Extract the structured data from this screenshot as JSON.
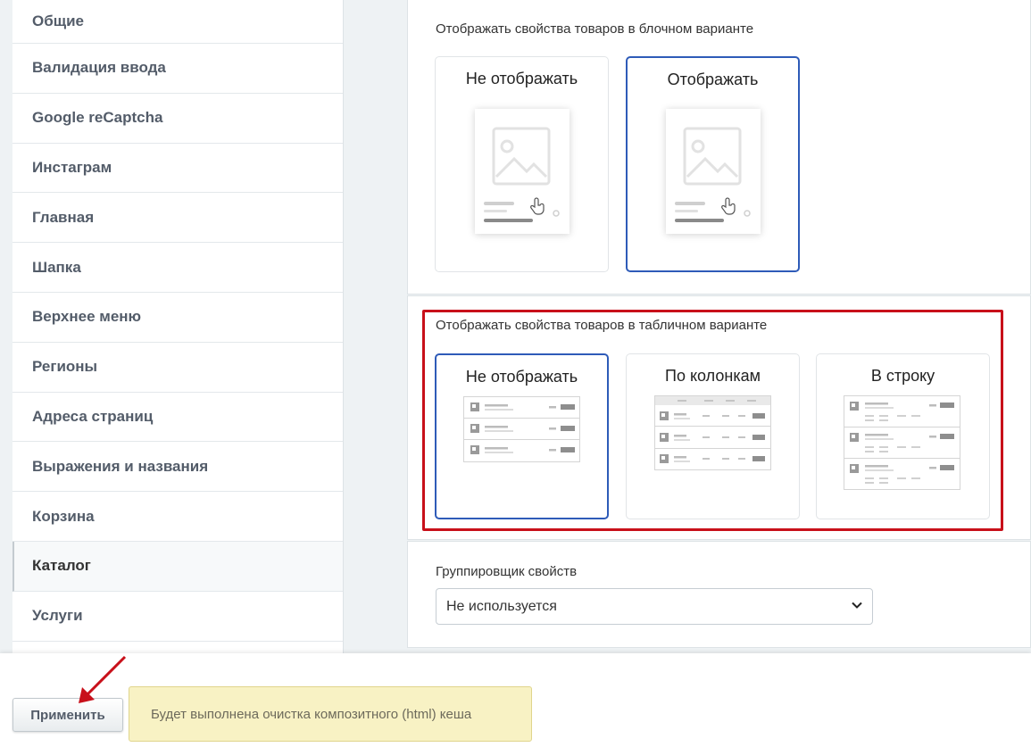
{
  "sidebar": {
    "items": [
      {
        "label": "Общие"
      },
      {
        "label": "Валидация ввода"
      },
      {
        "label": "Google reCaptcha"
      },
      {
        "label": "Инстаграм"
      },
      {
        "label": "Главная"
      },
      {
        "label": "Шапка"
      },
      {
        "label": "Верхнее меню"
      },
      {
        "label": "Регионы"
      },
      {
        "label": "Адреса страниц"
      },
      {
        "label": "Выражения и названия"
      },
      {
        "label": "Корзина"
      },
      {
        "label": "Каталог"
      },
      {
        "label": "Услуги"
      }
    ],
    "active": "Каталог"
  },
  "block_section": {
    "title": "Отображать свойства товаров в блочном варианте",
    "options": [
      {
        "label": "Не отображать",
        "selected": false
      },
      {
        "label": "Отображать",
        "selected": true
      }
    ]
  },
  "table_section": {
    "title": "Отображать свойства товаров в табличном варианте",
    "options": [
      {
        "label": "Не отображать",
        "selected": true
      },
      {
        "label": "По колонкам",
        "selected": false
      },
      {
        "label": "В строку",
        "selected": false
      }
    ]
  },
  "grouping": {
    "label": "Группировщик свойств",
    "value": "Не используется"
  },
  "footer": {
    "apply_label": "Применить",
    "notice": "Будет выполнена очистка композитного (html) кеша"
  },
  "colors": {
    "selected_border": "#2e5bb8",
    "highlight": "#c8101a",
    "notice_bg": "#f8f2c4"
  }
}
